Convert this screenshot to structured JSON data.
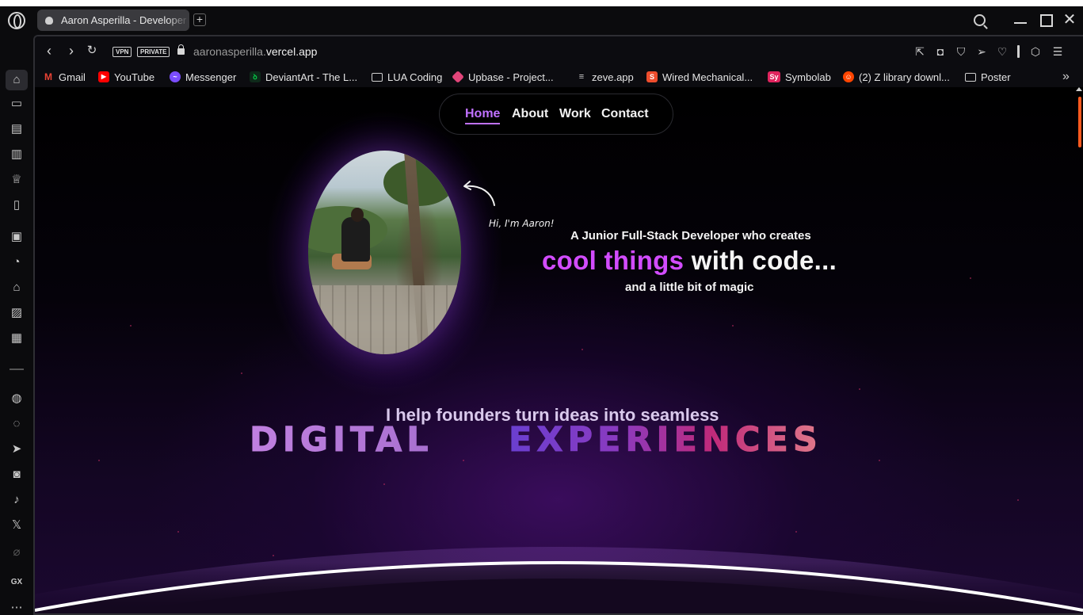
{
  "browser": {
    "tab_title": "Aaron Asperilla - Developer",
    "url_domain_prefix": "aaronasperilla.",
    "url_domain_main": "vercel.app",
    "vpn_label": "VPN",
    "private_label": "PRIVATE"
  },
  "bookmarks": [
    {
      "label": "Gmail",
      "icon": "gmail-icon",
      "color": "#ea4335"
    },
    {
      "label": "YouTube",
      "icon": "youtube-icon",
      "color": "#ff0000"
    },
    {
      "label": "Messenger",
      "icon": "messenger-icon",
      "color": "#7b4dff"
    },
    {
      "label": "DeviantArt - The L...",
      "icon": "deviantart-icon",
      "color": "#05cc47"
    },
    {
      "label": "LUA Coding",
      "icon": "folder-icon",
      "color": ""
    },
    {
      "label": "Upbase - Project...",
      "icon": "upbase-icon",
      "color": "#e2457a"
    },
    {
      "label": "zeve.app",
      "icon": "list-icon",
      "color": ""
    },
    {
      "label": "Wired Mechanical...",
      "icon": "shopee-icon",
      "color": "#ee4d2d"
    },
    {
      "label": "Symbolab",
      "icon": "symbolab-icon",
      "color": "#e0245e"
    },
    {
      "label": "(2) Z library downl...",
      "icon": "reddit-icon",
      "color": "#ff4500"
    },
    {
      "label": "Poster",
      "icon": "folder-icon",
      "color": ""
    }
  ],
  "site": {
    "nav": [
      "Home",
      "About",
      "Work",
      "Contact"
    ],
    "hi_text": "Hi, I'm Aaron!",
    "tagline": "A Junior Full-Stack Developer who creates",
    "headline_accent": "cool things",
    "headline_rest": " with code...",
    "subline": "and a little bit of magic",
    "help_line": "I help founders turn ideas into seamless",
    "big_word_1": "DIGITAL",
    "big_word_2": "EXPERIENCES"
  },
  "colors": {
    "accent_purple": "#d24cff",
    "nav_active": "#c071ff",
    "scroll_thumb": "#ff5a1f"
  }
}
